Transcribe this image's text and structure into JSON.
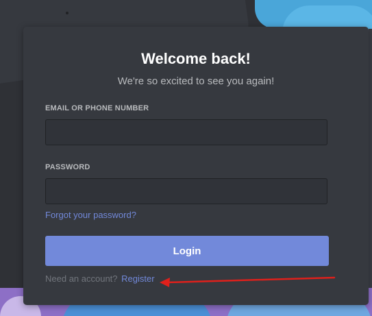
{
  "card": {
    "title": "Welcome back!",
    "subtitle": "We're so excited to see you again!"
  },
  "email": {
    "label": "EMAIL OR PHONE NUMBER",
    "value": ""
  },
  "password": {
    "label": "PASSWORD",
    "value": ""
  },
  "links": {
    "forgot_password": "Forgot your password?",
    "need_account": "Need an account?",
    "register": "Register"
  },
  "buttons": {
    "login": "Login"
  },
  "colors": {
    "accent": "#7289da",
    "card_bg": "#36393f",
    "annotation_arrow": "#e0201b"
  }
}
